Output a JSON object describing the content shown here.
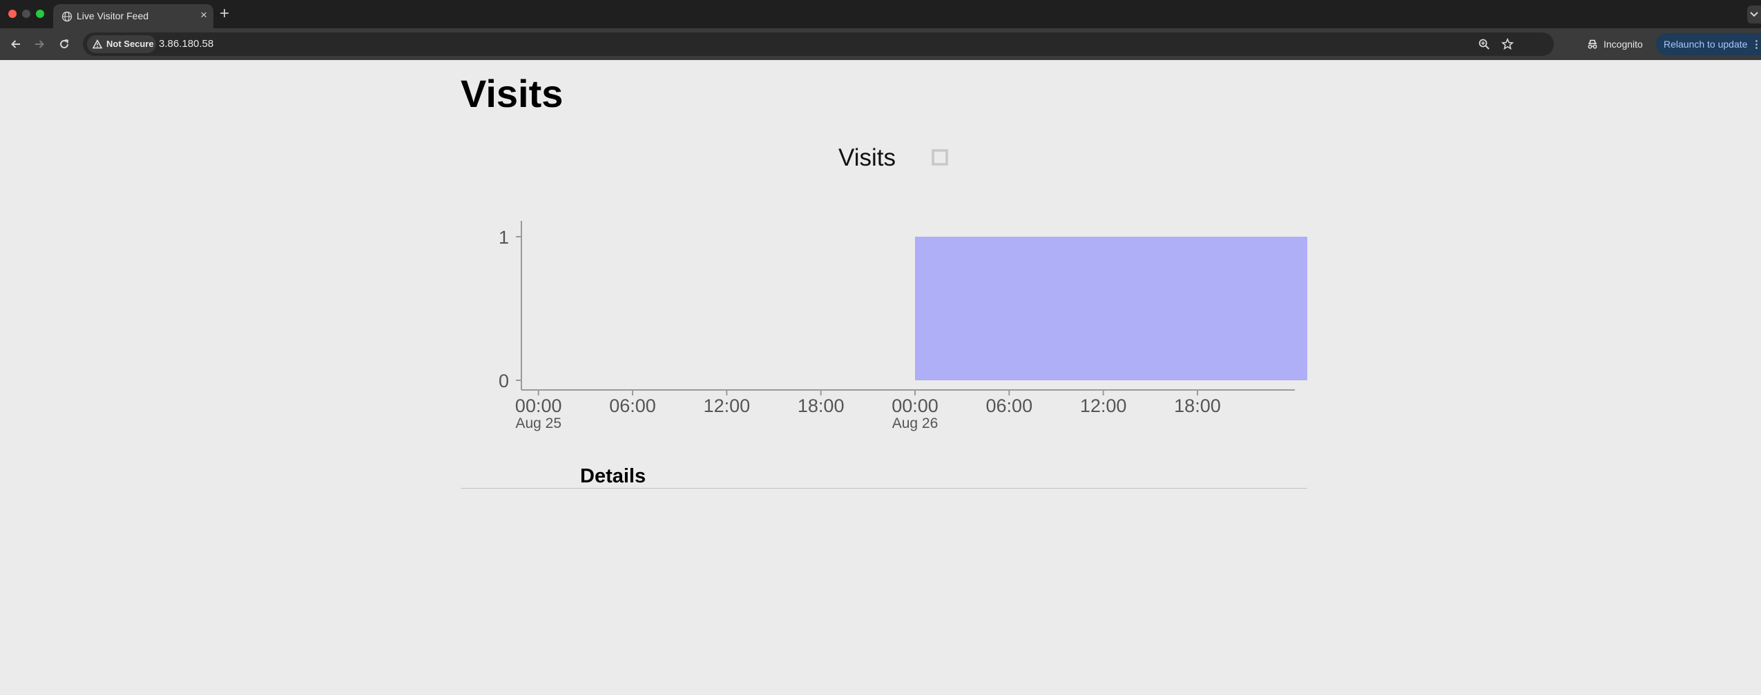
{
  "browser": {
    "tab_title": "Live Visitor Feed",
    "close_glyph": "×",
    "new_tab_glyph": "+",
    "security_label": "Not Secure",
    "url": "3.86.180.58",
    "incognito_label": "Incognito",
    "relaunch_label": "Relaunch to update",
    "menu_glyph": "⋮"
  },
  "page": {
    "title": "Visits",
    "details_heading": "Details"
  },
  "colors": {
    "bar_fill": "#aeaff7",
    "axis": "#9a9a9a",
    "tick_text": "#555555",
    "legend_box": "#c8c8c8"
  },
  "chart_data": {
    "type": "area",
    "title": "Visits",
    "legend": [
      {
        "name": "Visits",
        "swatch": "outline-square"
      }
    ],
    "x_ticks": [
      {
        "label": "00:00",
        "sublabel": "Aug 25",
        "t": 0
      },
      {
        "label": "06:00",
        "sublabel": "",
        "t": 6
      },
      {
        "label": "12:00",
        "sublabel": "",
        "t": 12
      },
      {
        "label": "18:00",
        "sublabel": "",
        "t": 18
      },
      {
        "label": "00:00",
        "sublabel": "Aug 26",
        "t": 24
      },
      {
        "label": "06:00",
        "sublabel": "",
        "t": 30
      },
      {
        "label": "12:00",
        "sublabel": "",
        "t": 36
      },
      {
        "label": "18:00",
        "sublabel": "",
        "t": 42
      }
    ],
    "xlim": [
      -1,
      49
    ],
    "y_ticks": [
      0,
      1
    ],
    "ylim": [
      0,
      1
    ],
    "series": [
      {
        "name": "Visits",
        "x": [
          24,
          49
        ],
        "y": [
          1,
          1
        ],
        "baseline": 0
      }
    ],
    "xunit_note": "hours from Aug 25 00:00"
  }
}
